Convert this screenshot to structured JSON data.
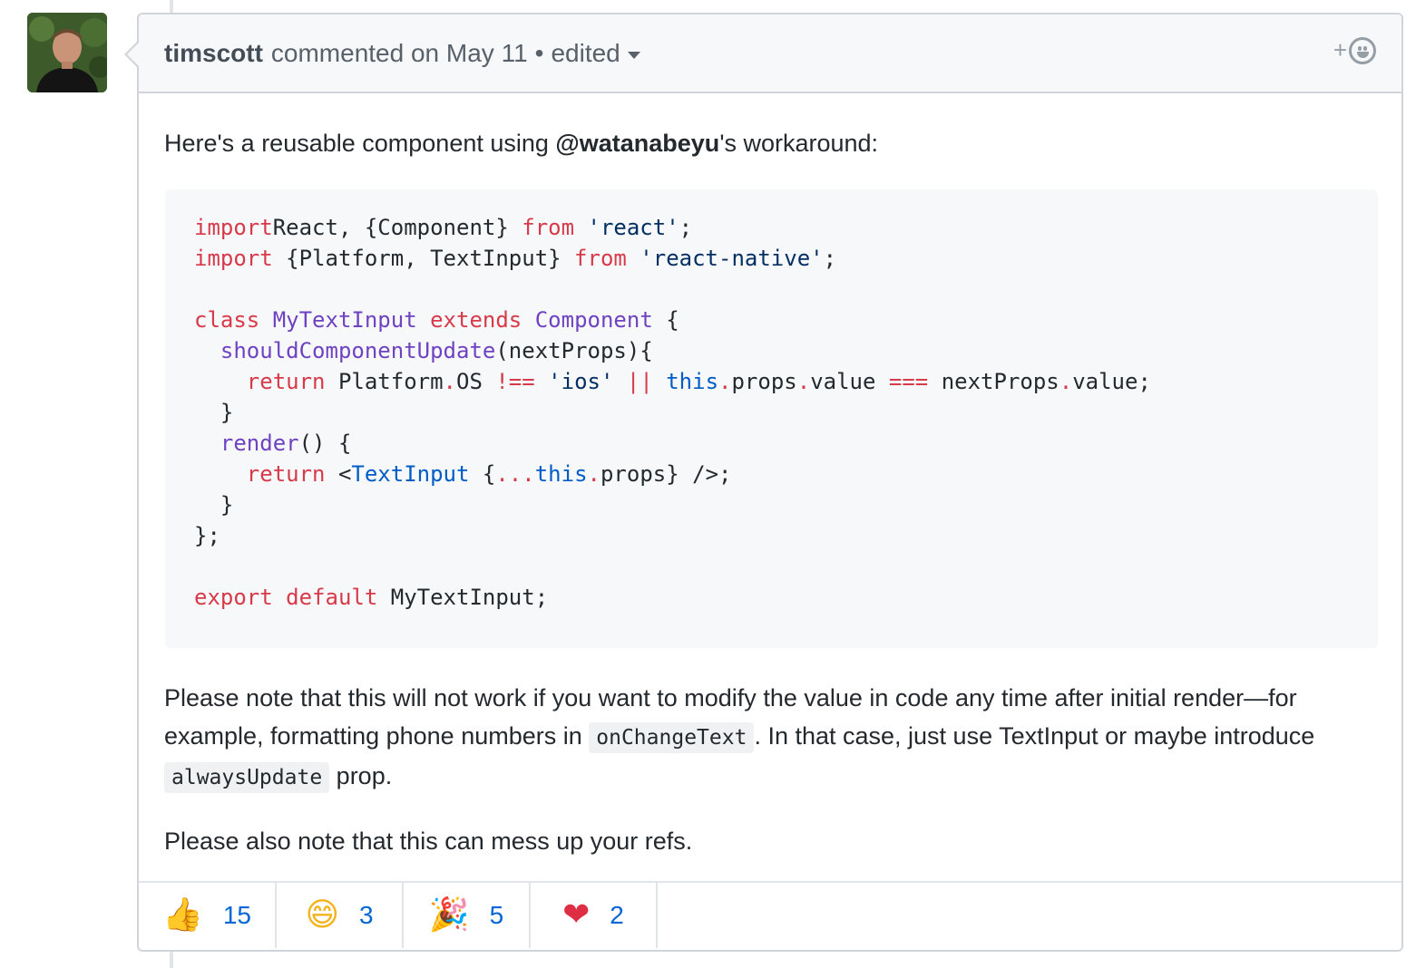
{
  "comment": {
    "author": "timscott",
    "action_text": "commented on May 11",
    "separator": "•",
    "edited_label": "edited",
    "add_reaction_plus": "+",
    "intro": {
      "before": "Here's a reusable component using ",
      "mention": "@watanabeyu",
      "after": "'s workaround:"
    },
    "note1": {
      "part1": "Please note that this will not work if you want to modify the value in code any time after initial render—for example, formatting phone numbers in ",
      "code1": "onChangeText",
      "part2": ". In that case, just use TextInput or maybe introduce ",
      "code2": "alwaysUpdate",
      "part3": " prop."
    },
    "note2": "Please also note that this can mess up your refs."
  },
  "code_lines": [
    [
      [
        "kw",
        "import"
      ],
      [
        "",
        "React, {Component} "
      ],
      [
        "kw",
        "from"
      ],
      [
        "",
        " "
      ],
      [
        "str",
        "'react'"
      ],
      [
        "",
        ";"
      ]
    ],
    [
      [
        "kw",
        "import"
      ],
      [
        "",
        " {Platform, TextInput} "
      ],
      [
        "kw",
        "from"
      ],
      [
        "",
        " "
      ],
      [
        "str",
        "'react-native'"
      ],
      [
        "",
        ";"
      ]
    ],
    [],
    [
      [
        "kw",
        "class"
      ],
      [
        "",
        " "
      ],
      [
        "ent",
        "MyTextInput"
      ],
      [
        "",
        " "
      ],
      [
        "kw",
        "extends"
      ],
      [
        "",
        " "
      ],
      [
        "ent",
        "Component"
      ],
      [
        "",
        " {"
      ]
    ],
    [
      [
        "",
        "  "
      ],
      [
        "ent",
        "shouldComponentUpdate"
      ],
      [
        "",
        "(nextProps){"
      ]
    ],
    [
      [
        "",
        "    "
      ],
      [
        "kw",
        "return"
      ],
      [
        "",
        " Platform"
      ],
      [
        "kw",
        "."
      ],
      [
        "",
        "OS "
      ],
      [
        "kw",
        "!=="
      ],
      [
        "",
        " "
      ],
      [
        "str",
        "'ios'"
      ],
      [
        "",
        " "
      ],
      [
        "kw",
        "||"
      ],
      [
        "",
        " "
      ],
      [
        "cst",
        "this"
      ],
      [
        "kw",
        "."
      ],
      [
        "",
        "props"
      ],
      [
        "kw",
        "."
      ],
      [
        "",
        "value "
      ],
      [
        "kw",
        "==="
      ],
      [
        "",
        " nextProps"
      ],
      [
        "kw",
        "."
      ],
      [
        "",
        "value;"
      ]
    ],
    [
      [
        "",
        "  }"
      ]
    ],
    [
      [
        "",
        "  "
      ],
      [
        "ent",
        "render"
      ],
      [
        "",
        "() {"
      ]
    ],
    [
      [
        "",
        "    "
      ],
      [
        "kw",
        "return"
      ],
      [
        "",
        " <"
      ],
      [
        "cst",
        "TextInput"
      ],
      [
        "",
        " {"
      ],
      [
        "kw",
        "..."
      ],
      [
        "cst",
        "this"
      ],
      [
        "kw",
        "."
      ],
      [
        "",
        "props} />;"
      ]
    ],
    [
      [
        "",
        "  }"
      ]
    ],
    [
      [
        "",
        "};"
      ]
    ],
    [],
    [
      [
        "kw",
        "export"
      ],
      [
        "",
        " "
      ],
      [
        "kw",
        "default"
      ],
      [
        "",
        " MyTextInput;"
      ]
    ]
  ],
  "reactions": [
    {
      "emoji": "👍",
      "icon": "thumbs-up-icon",
      "count": "15"
    },
    {
      "emoji": "😄",
      "icon": "laugh-icon",
      "count": "3"
    },
    {
      "emoji": "🎉",
      "icon": "tada-icon",
      "count": "5"
    },
    {
      "emoji": "❤",
      "icon": "heart-icon",
      "count": "2"
    }
  ],
  "colors": {
    "keyword": "#d73a49",
    "entity": "#6f42c1",
    "string": "#032f62",
    "constant": "#005cc5",
    "reaction_count": "#0366d6"
  }
}
